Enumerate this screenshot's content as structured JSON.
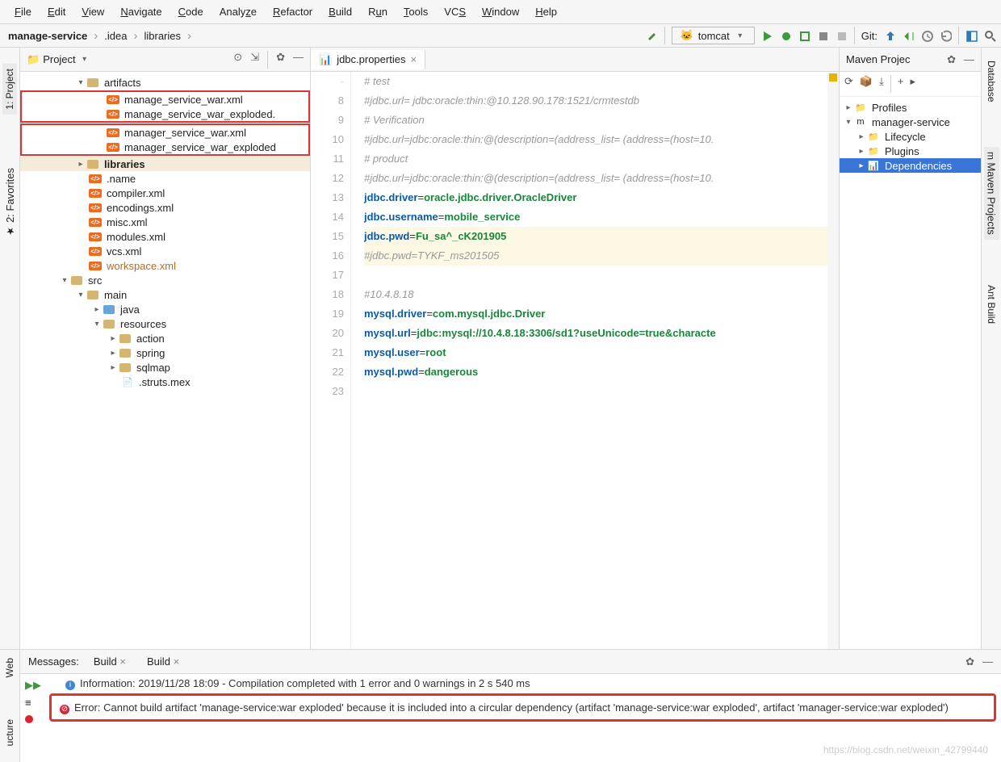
{
  "menu": {
    "file": "File",
    "edit": "Edit",
    "view": "View",
    "navigate": "Navigate",
    "code": "Code",
    "analyze": "Analyze",
    "refactor": "Refactor",
    "build": "Build",
    "run": "Run",
    "tools": "Tools",
    "vcs": "VCS",
    "window": "Window",
    "help": "Help"
  },
  "breadcrumb": {
    "a": "manage-service",
    "b": ".idea",
    "c": "libraries"
  },
  "runconfig": "tomcat",
  "git_label": "Git:",
  "project": {
    "title": "Project",
    "artifacts": "artifacts",
    "a1": "manage_service_war.xml",
    "a2": "manage_service_war_exploded.",
    "a3": "manager_service_war.xml",
    "a4": "manager_service_war_exploded",
    "libraries": "libraries",
    "f1": ".name",
    "f2": "compiler.xml",
    "f3": "encodings.xml",
    "f4": "misc.xml",
    "f5": "modules.xml",
    "f6": "vcs.xml",
    "f7": "workspace.xml",
    "src": "src",
    "main": "main",
    "java": "java",
    "resources": "resources",
    "action": "action",
    "spring": "spring",
    "sqlmap": "sqlmap",
    "struts": ".struts.mex"
  },
  "tab": "jdbc.properties",
  "code": {
    "l8": "#jdbc.url= jdbc:oracle:thin:@10.128.90.178:1521/crmtestdb",
    "l9": "# Verification",
    "l10": "#jdbc.url=jdbc:oracle:thin:@(description=(address_list= (address=(host=10.",
    "l11": "# product",
    "l12": "#jdbc.url=jdbc:oracle:thin:@(description=(address_list= (address=(host=10.",
    "l13k": "jdbc.driver",
    "l13v": "oracle.jdbc.driver.OracleDriver",
    "l14k": "jdbc.username",
    "l14v": "mobile_service",
    "l15k": "jdbc.pwd",
    "l15v": "Fu_sa^_cK201905",
    "l16": "#jdbc.pwd=TYKF_ms201505",
    "l18": "#10.4.8.18",
    "l19k": "mysql.driver",
    "l19v": "com.mysql.jdbc.Driver",
    "l20k": "mysql.url",
    "l20v": "jdbc:mysql://10.4.8.18:3306/sd1?useUnicode=true&characte",
    "l21k": "mysql.user",
    "l21v": "root",
    "l22k": "mysql.pwd",
    "l22v": "dangerous",
    "top": "# test"
  },
  "lines": [
    "8",
    "9",
    "10",
    "11",
    "12",
    "13",
    "14",
    "15",
    "16",
    "17",
    "18",
    "19",
    "20",
    "21",
    "22",
    "23"
  ],
  "maven": {
    "title": "Maven Projec",
    "profiles": "Profiles",
    "root": "manager-service",
    "lifecycle": "Lifecycle",
    "plugins": "Plugins",
    "deps": "Dependencies"
  },
  "ltabs": {
    "project": "1: Project",
    "fav": "2: Favorites",
    "struct": "ucture",
    "web": "Web"
  },
  "rtabs": {
    "db": "Database",
    "mvn": "Maven Projects",
    "ant": "Ant Build"
  },
  "messages": {
    "label": "Messages:",
    "build": "Build",
    "info": "Information: 2019/11/28 18:09 - Compilation completed with 1 error and 0 warnings in 2 s 540 ms",
    "err": "Error: Cannot build artifact 'manage-service:war exploded' because it is included into a circular dependency (artifact 'manage-service:war exploded', artifact 'manager-service:war exploded')"
  },
  "watermark": "https://blog.csdn.net/weixin_42799440"
}
